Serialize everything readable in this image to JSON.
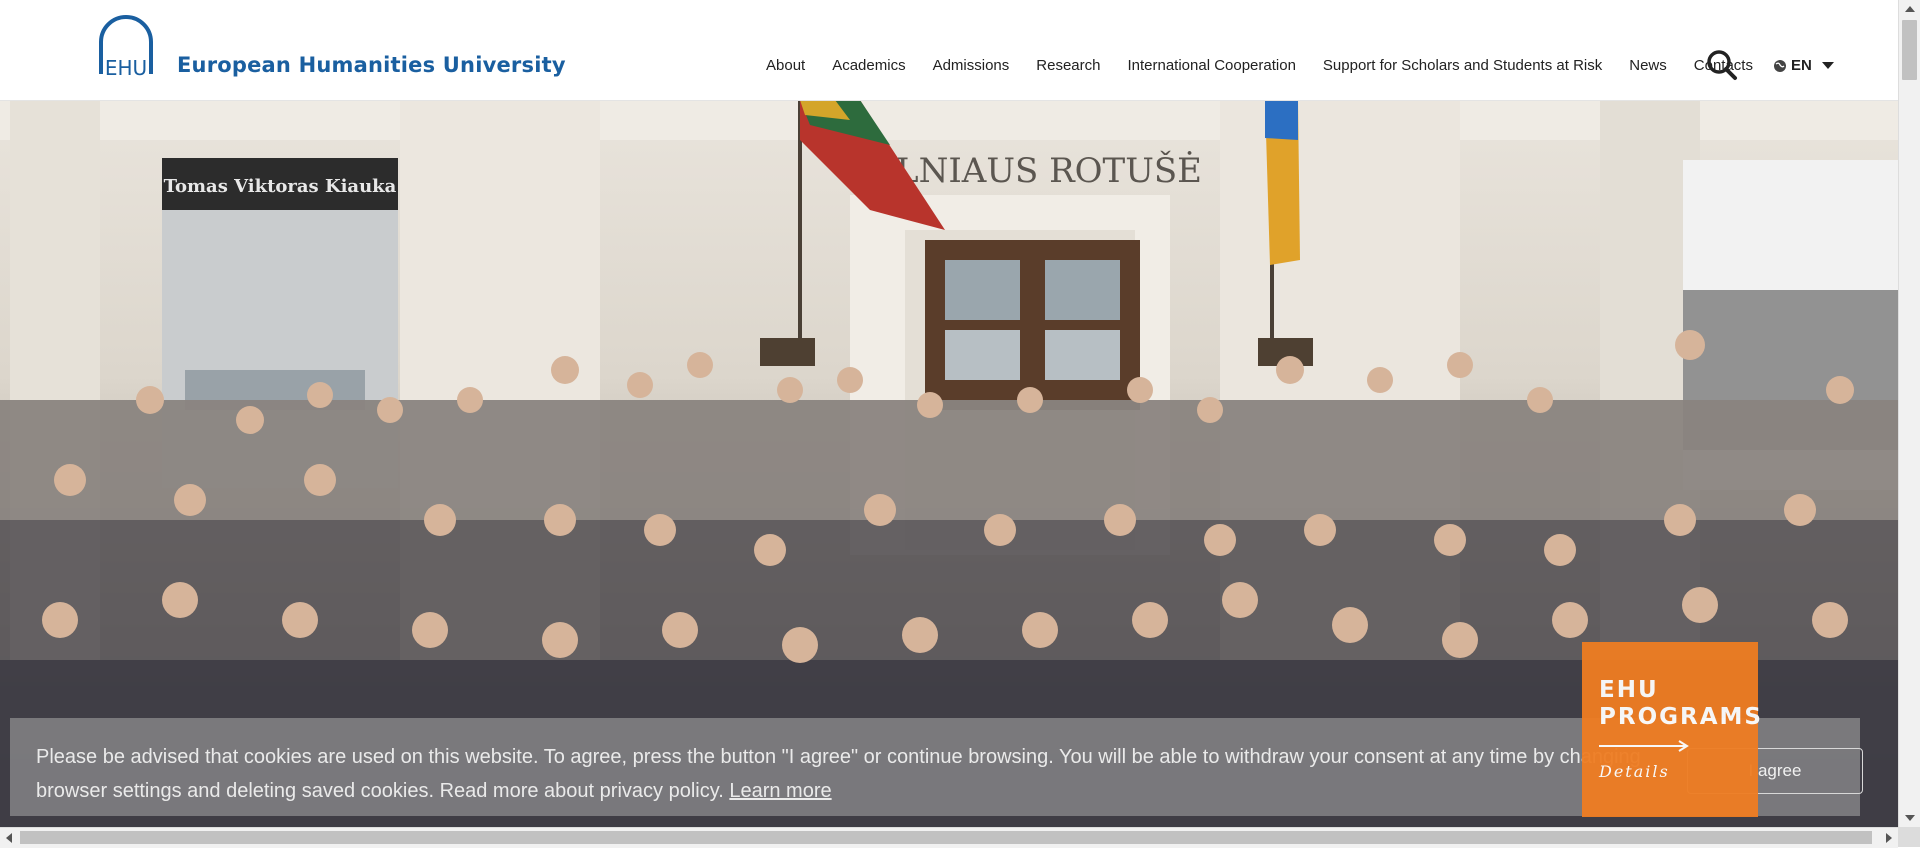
{
  "header": {
    "logo_text": "EHU",
    "brand": "European Humanities University",
    "nav": [
      "About",
      "Academics",
      "Admissions",
      "Research",
      "International Cooperation",
      "Support for Scholars and Students at Risk",
      "News",
      "Contacts"
    ],
    "language": "EN"
  },
  "hero": {
    "building_sign": "VILNIAUS ROTUŠĖ",
    "banner_name": "Tomas Viktoras Kiauka"
  },
  "cookie": {
    "text": "Please be advised that cookies are used on this website. To agree, press the button \"I agree\" or continue browsing. You will be able to withdraw your consent at any time by changing browser settings and deleting saved cookies. Read more about privacy policy.",
    "learn_more": "Learn more",
    "agree_button": "I agree"
  },
  "programs": {
    "line1": "EHU",
    "line2": "PROGRAMS",
    "details": "Details"
  },
  "colors": {
    "brand_blue": "#1a5fa0",
    "programs_orange": "#ef7d22"
  }
}
